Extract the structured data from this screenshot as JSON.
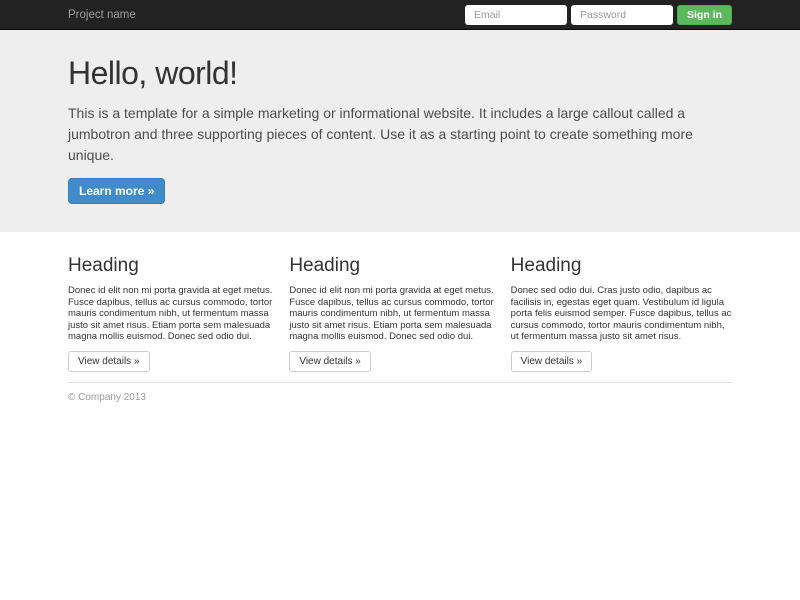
{
  "navbar": {
    "brand": "Project name",
    "email_placeholder": "Email",
    "password_placeholder": "Password",
    "sign_in_label": "Sign in",
    "bg_color": "#222222",
    "brand_color": "#9d9d9d",
    "sign_in_bg_color": "#5cb85c"
  },
  "jumbotron": {
    "title": "Hello, world!",
    "description": "This is a template for a simple marketing or informational website. It includes a large callout called a jumbotron and three supporting pieces of content. Use it as a starting point to create something more unique.",
    "cta_label": "Learn more »",
    "bg_color": "#eeeeee",
    "cta_bg_color": "#428bca"
  },
  "columns": [
    {
      "heading": "Heading",
      "body": "Donec id elit non mi porta gravida at eget metus. Fusce dapibus, tellus ac cursus commodo, tortor mauris condimentum nibh, ut fermentum massa justo sit amet risus. Etiam porta sem malesuada magna mollis euismod. Donec sed odio dui.",
      "button_label": "View details »"
    },
    {
      "heading": "Heading",
      "body": "Donec id elit non mi porta gravida at eget metus. Fusce dapibus, tellus ac cursus commodo, tortor mauris condimentum nibh, ut fermentum massa justo sit amet risus. Etiam porta sem malesuada magna mollis euismod. Donec sed odio dui.",
      "button_label": "View details »"
    },
    {
      "heading": "Heading",
      "body": "Donec sed odio dui. Cras justo odio, dapibus ac facilisis in, egestas eget quam. Vestibulum id ligula porta felis euismod semper. Fusce dapibus, tellus ac cursus commodo, tortor mauris condimentum nibh, ut fermentum massa justo sit amet risus.",
      "button_label": "View details »"
    }
  ],
  "footer": {
    "copyright": "© Company 2013"
  }
}
